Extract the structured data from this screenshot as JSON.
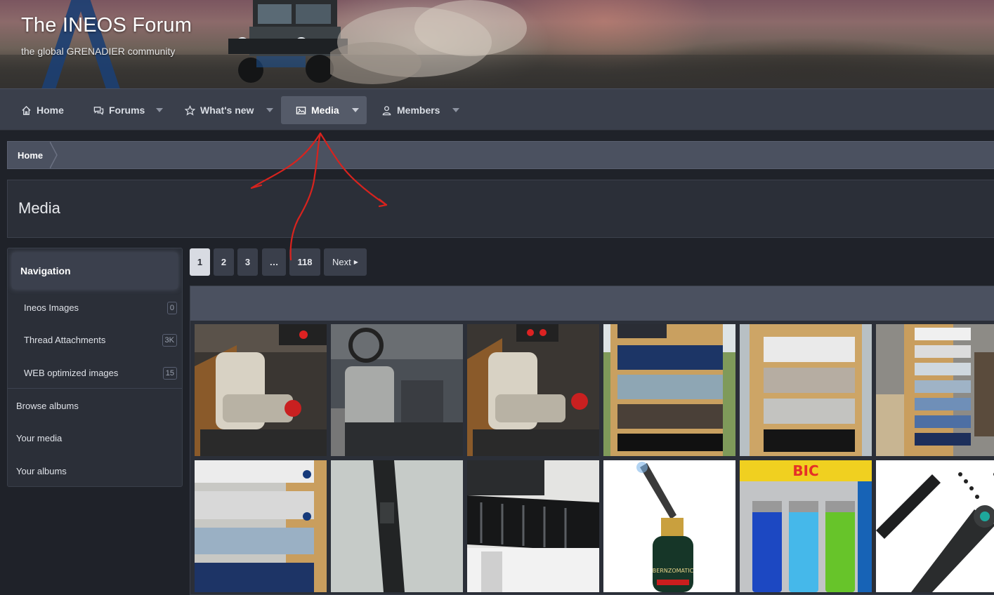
{
  "header": {
    "title": "The INEOS Forum",
    "tagline": "the global GRENADIER community"
  },
  "nav": {
    "items": [
      {
        "label": "Home",
        "icon": "home-icon",
        "active": false,
        "has_menu": false
      },
      {
        "label": "Forums",
        "icon": "chat-bubbles-icon",
        "active": false,
        "has_menu": true
      },
      {
        "label": "What's new",
        "icon": "star-icon",
        "active": false,
        "has_menu": true
      },
      {
        "label": "Media",
        "icon": "image-icon",
        "active": true,
        "has_menu": true
      },
      {
        "label": "Members",
        "icon": "user-icon",
        "active": false,
        "has_menu": true
      }
    ]
  },
  "breadcrumb": {
    "home": "Home"
  },
  "page": {
    "title": "Media"
  },
  "sidebar": {
    "heading": "Navigation",
    "categories": [
      {
        "label": "Ineos Images",
        "count": "0"
      },
      {
        "label": "Thread Attachments",
        "count": "3K"
      },
      {
        "label": "WEB optimized images",
        "count": "15"
      }
    ],
    "links": [
      {
        "label": "Browse albums"
      },
      {
        "label": "Your media"
      },
      {
        "label": "Your albums"
      }
    ]
  },
  "pagination": {
    "pages": [
      "1",
      "2",
      "3",
      "…",
      "118"
    ],
    "current": "1",
    "next_label": "Next"
  },
  "thumbnails": [
    "car-interior-seat-photo",
    "car-interior-dashboard-photo",
    "car-interior-seat-photo",
    "color-swatch-board-photo",
    "color-swatch-board-photo",
    "color-swatch-rack-photo",
    "color-swatch-panels-photo",
    "tactical-pen-photo",
    "roof-rack-photo",
    "butane-torch-photo",
    "bic-lighters-pack-photo",
    "ferro-rod-fire-starter-photo"
  ],
  "bic_label": "BIC",
  "torch_brand": "BERNZOMATIC",
  "colors": {
    "navbar": "#3a3f4b",
    "active_tab": "#555b69",
    "panel": "#2b2f38",
    "annotation": "#d8231e"
  }
}
